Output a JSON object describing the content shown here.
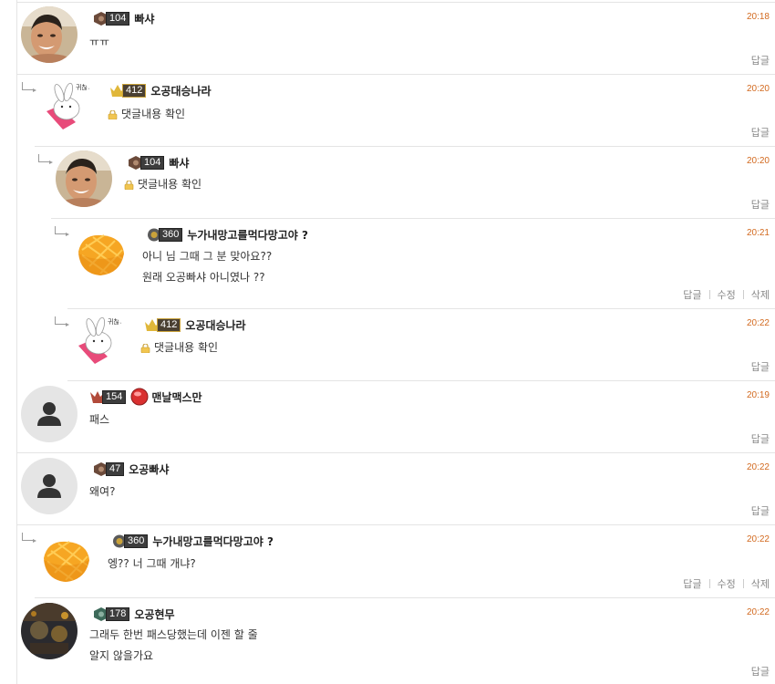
{
  "colors": {
    "time": "#d2691e",
    "separator": "#e4e4e4",
    "action": "#888888"
  },
  "labels": {
    "reply": "답글",
    "edit": "수정",
    "delete": "삭제"
  },
  "comments": [
    {
      "nickname": "빠샤",
      "level": "104",
      "time": "20:18",
      "lines": [
        "ㅠㅠ"
      ],
      "avatar": "face-photo"
    },
    {
      "nickname": "오공대승나라",
      "level": "412",
      "time": "20:20",
      "lines": [
        "댓글내용 확인"
      ],
      "locked": true,
      "avatar": "bunny-sticker",
      "avatar_text": "귀찮ㄴ"
    },
    {
      "nickname": "빠샤",
      "level": "104",
      "time": "20:20",
      "lines": [
        "댓글내용 확인"
      ],
      "locked": true,
      "avatar": "face-photo"
    },
    {
      "nickname": "누가내망고를먹다망고야 ?",
      "level": "360",
      "time": "20:21",
      "lines": [
        "아니 님 그때 그 분 맞아요??",
        "원래 오공빠샤 아니였나 ??"
      ],
      "avatar": "mango"
    },
    {
      "nickname": "오공대승나라",
      "level": "412",
      "time": "20:22",
      "lines": [
        "댓글내용 확인"
      ],
      "locked": true,
      "avatar": "bunny-sticker",
      "avatar_text": "귀찮ㄴ"
    },
    {
      "nickname": "맨날맥스만",
      "level": "154",
      "time": "20:19",
      "lines": [
        "패스"
      ],
      "avatar": "default-user"
    },
    {
      "nickname": "오공빠샤",
      "level": "47",
      "time": "20:22",
      "lines": [
        "왜여?"
      ],
      "avatar": "default-user"
    },
    {
      "nickname": "누가내망고를먹다망고야 ?",
      "level": "360",
      "time": "20:22",
      "lines": [
        "엥?? 너 그때 개냐?"
      ],
      "avatar": "mango"
    },
    {
      "nickname": "오공현무",
      "level": "178",
      "time": "20:22",
      "lines": [
        "그래두 한번 패스당했는데 이젠 할 줄",
        "알지 않을가요"
      ],
      "avatar": "dark-photo"
    }
  ]
}
